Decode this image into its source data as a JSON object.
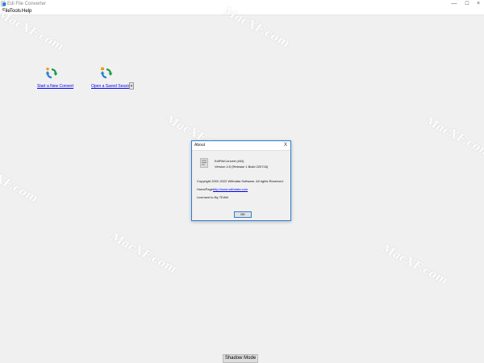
{
  "window": {
    "title": "Edi File Converter",
    "controls": {
      "minimize": "—",
      "maximize": "☐",
      "close": "×"
    },
    "icon": "app-icon"
  },
  "menu": {
    "file": "File",
    "tools": "Tools",
    "help": "Help"
  },
  "actions": {
    "new_convert": {
      "label": "Start a New Convert",
      "icon": "convert-arrows-icon"
    },
    "open_session": {
      "label": "Open a Saved Session",
      "icon": "open-session-icon"
    },
    "dropdown_glyph": "▾"
  },
  "watermark": "MacXF.com",
  "about_dialog": {
    "title": "About",
    "close": "X",
    "product": "EdiFileConvert (x64)",
    "version": "Version 4.5 (Release 1 Build 220716)",
    "copyright": "Copyright 2002-2022 Withdata Software. All rights Reserved.",
    "homepage_label": "HomePage:",
    "homepage_url": "http://www.withdata.com",
    "licensed_label": "Licensed to:",
    "licensed_to": "By TEAM",
    "ok": "OK"
  },
  "bottom": {
    "shadow_mode": "Shadow Mode"
  },
  "colors": {
    "accent": "#2b7fd4",
    "link": "#0000ee",
    "background": "#f0f0f0"
  }
}
